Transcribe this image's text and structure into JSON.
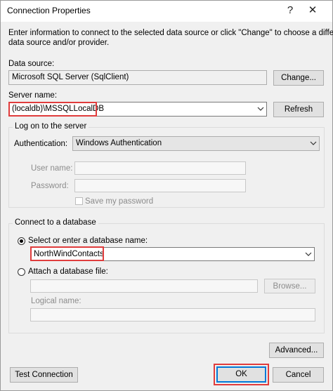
{
  "window": {
    "title": "Connection Properties",
    "help_glyph": "?",
    "close_glyph": "✕"
  },
  "intro": {
    "line1": "Enter information to connect to the selected data source or click \"Change\" to choose a different",
    "line2": "data source and/or provider."
  },
  "data_source": {
    "label": "Data source:",
    "value": "Microsoft SQL Server (SqlClient)",
    "change_label": "Change..."
  },
  "server": {
    "label": "Server name:",
    "value": "(localdb)\\MSSQLLocalDB",
    "refresh_label": "Refresh"
  },
  "logon": {
    "legend": "Log on to the server",
    "auth_label": "Authentication:",
    "auth_value": "Windows Authentication",
    "username_label": "User name:",
    "username_value": "",
    "password_label": "Password:",
    "password_value": "",
    "save_password_label": "Save my password",
    "save_password_checked": false
  },
  "database": {
    "legend": "Connect to a database",
    "select_label": "Select or enter a database name:",
    "select_checked": true,
    "db_name": "NorthWindContacts",
    "attach_label": "Attach a database file:",
    "attach_value": "",
    "browse_label": "Browse...",
    "logical_label": "Logical name:",
    "logical_value": ""
  },
  "buttons": {
    "advanced": "Advanced...",
    "test": "Test Connection",
    "ok": "OK",
    "cancel": "Cancel"
  },
  "colors": {
    "highlight": "#e03c3c",
    "dialog_bg": "#f0f0f0",
    "ok_border": "#0078d7"
  }
}
